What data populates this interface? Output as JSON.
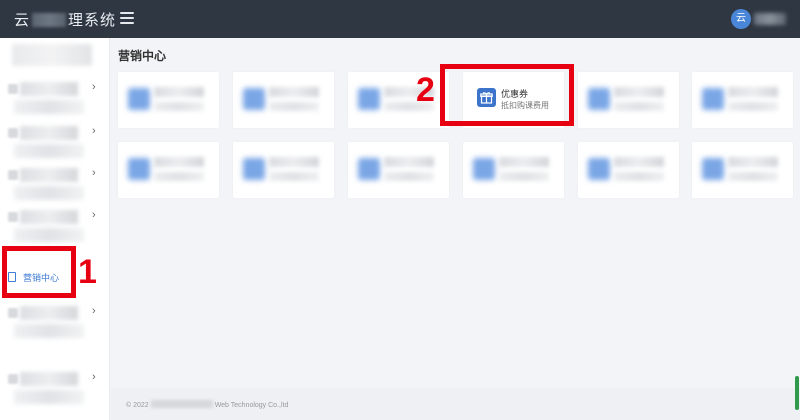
{
  "header": {
    "brand_prefix": "云",
    "brand_suffix": "理系统",
    "avatar_char": "云"
  },
  "sidebar": {
    "active_item_label": "营销中心",
    "chevron": "›"
  },
  "main": {
    "page_title": "营销中心",
    "featured_card": {
      "title": "优惠券",
      "subtitle": "抵扣购课费用",
      "icon": "gift-icon",
      "accent": "#3c74cc"
    }
  },
  "annotations": {
    "marker_1": "1",
    "marker_2": "2",
    "color": "#e60012"
  },
  "footer": {
    "copyright_prefix": "© 2022",
    "copyright_suffix": "Web Technology Co.,ltd"
  }
}
